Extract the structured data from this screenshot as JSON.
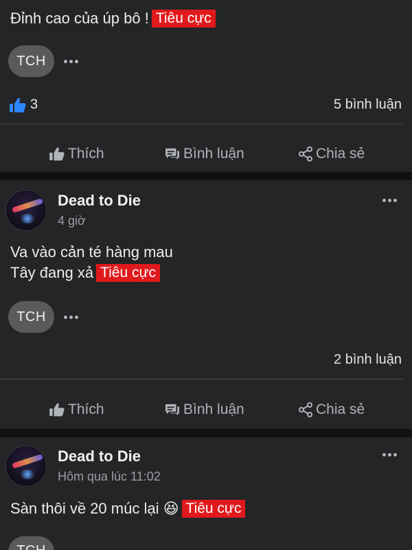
{
  "posts": [
    {
      "message_lines": [
        "Đỉnh cao của úp bô !"
      ],
      "tag": "Tiêu cực",
      "reactor": "TCH",
      "likes": "3",
      "comments": "5 bình luận"
    },
    {
      "author": "Dead to Die",
      "time": "4 giờ",
      "message_lines": [
        "Va vào cản té hàng mau",
        "Tây đang xả"
      ],
      "tag": "Tiêu cực",
      "reactor": "TCH",
      "comments": "2 bình luận"
    },
    {
      "author": "Dead to Die",
      "time": "Hôm qua lúc 11:02",
      "message_lines": [
        "Sàn thôi về 20 múc lại 😆"
      ],
      "tag": "Tiêu cực",
      "reactor": "TCH"
    }
  ],
  "actions": {
    "like": "Thích",
    "comment": "Bình luận",
    "share": "Chia sẻ"
  },
  "colors": {
    "tag": "#e0191c",
    "card": "#242526",
    "like_blue": "#2d88ff"
  }
}
